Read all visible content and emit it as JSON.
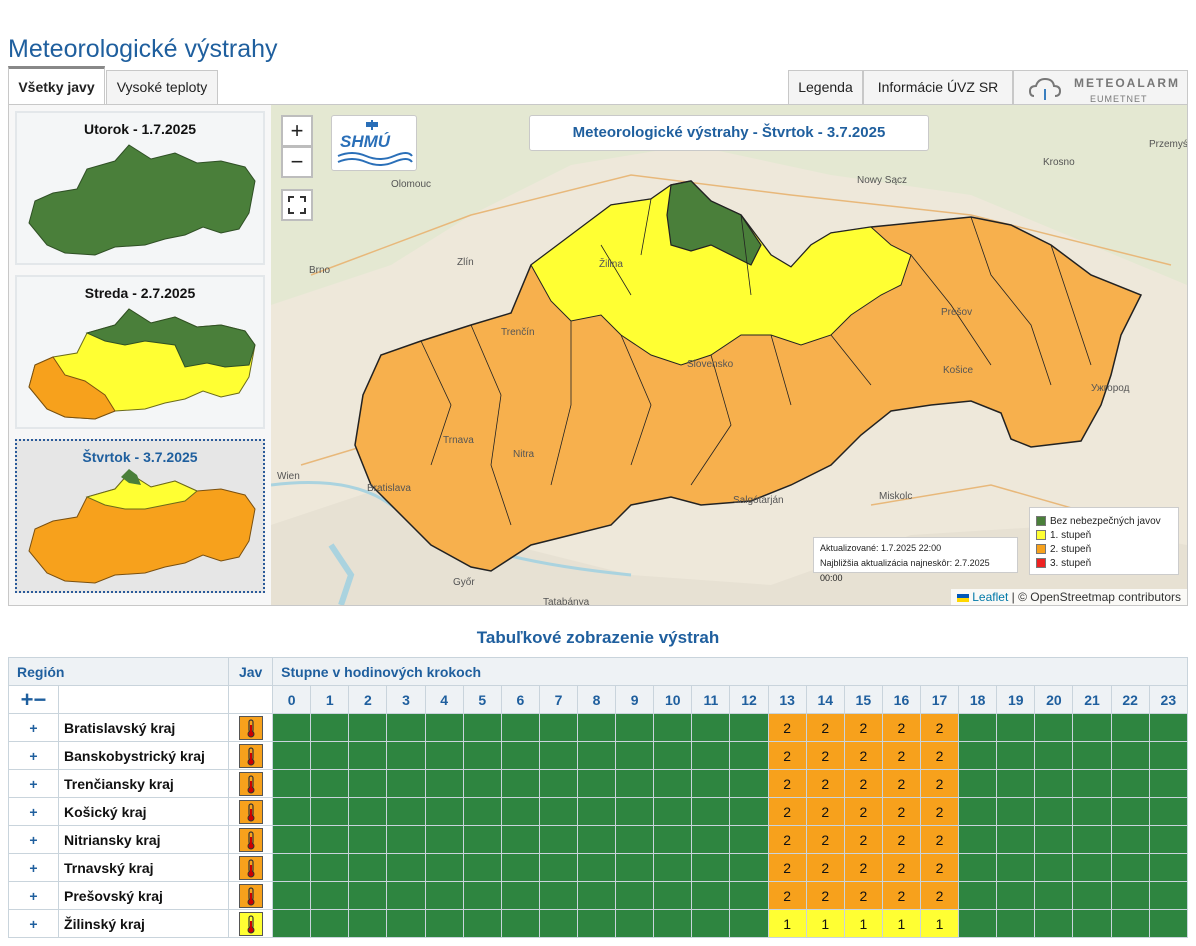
{
  "page": {
    "title": "Meteorologické výstrahy"
  },
  "tabs": {
    "left": [
      {
        "label": "Všetky javy",
        "active": true
      },
      {
        "label": "Vysoké teploty",
        "active": false
      }
    ],
    "right": [
      {
        "label": "Legenda"
      },
      {
        "label": "Informácie ÚVZ SR"
      }
    ],
    "meteoalarm": {
      "title": "METEOALARM",
      "subtitle": "EUMETNET"
    }
  },
  "days": [
    {
      "label": "Utorok - 1.7.2025",
      "selected": false
    },
    {
      "label": "Streda - 2.7.2025",
      "selected": false
    },
    {
      "label": "Štvrtok - 3.7.2025",
      "selected": true
    }
  ],
  "map": {
    "title": "Meteorologické výstrahy - Štvrtok - 3.7.2025",
    "zoom_in": "+",
    "zoom_out": "−",
    "fullscreen_icon": "fullscreen-icon",
    "logo_text": "SHMÚ",
    "cities": [
      "Olomouc",
      "Zlín",
      "Brno",
      "Nowy Sącz",
      "Krosno",
      "Przemyś",
      "Žilina",
      "Trenčín",
      "Prešov",
      "Košice",
      "Slovensko",
      "Ужгород",
      "Trnava",
      "Nitra",
      "Wien",
      "Bratislava",
      "Győr",
      "Salgótarján",
      "Miskolc",
      "Tatabánya"
    ],
    "update": {
      "updated": "Aktualizované: 1.7.2025 22:00",
      "next": "Najbližšia aktualizácia najneskôr: 2.7.2025 00:00"
    },
    "legend": [
      {
        "label": "Bez nebezpečných javov",
        "color": "#4a7f3a"
      },
      {
        "label": "1. stupeň",
        "color": "#ffff33"
      },
      {
        "label": "2. stupeň",
        "color": "#f7a11c"
      },
      {
        "label": "3. stupeň",
        "color": "#ee2222"
      }
    ],
    "attribution": {
      "leaflet": "Leaflet",
      "osm": "| © OpenStreetmap contributors"
    }
  },
  "colors": {
    "green": "#2e8540",
    "yellow": "#ffff33",
    "orange": "#f7a11c",
    "red": "#ee2222",
    "title_blue": "#1f5f9e"
  },
  "table": {
    "title": "Tabuľkové zobrazenie výstrah",
    "header": {
      "region": "Región",
      "jav": "Jav",
      "steps": "Stupne v hodinových krokoch"
    },
    "expand_collapse": "+−",
    "hours": [
      "0",
      "1",
      "2",
      "3",
      "4",
      "5",
      "6",
      "7",
      "8",
      "9",
      "10",
      "11",
      "12",
      "13",
      "14",
      "15",
      "16",
      "17",
      "18",
      "19",
      "20",
      "21",
      "22",
      "23"
    ],
    "rows": [
      {
        "region": "Bratislavský kraj",
        "jav_level": 2,
        "levels": [
          0,
          0,
          0,
          0,
          0,
          0,
          0,
          0,
          0,
          0,
          0,
          0,
          0,
          2,
          2,
          2,
          2,
          2,
          0,
          0,
          0,
          0,
          0,
          0
        ]
      },
      {
        "region": "Banskobystrický kraj",
        "jav_level": 2,
        "levels": [
          0,
          0,
          0,
          0,
          0,
          0,
          0,
          0,
          0,
          0,
          0,
          0,
          0,
          2,
          2,
          2,
          2,
          2,
          0,
          0,
          0,
          0,
          0,
          0
        ]
      },
      {
        "region": "Trenčiansky kraj",
        "jav_level": 2,
        "levels": [
          0,
          0,
          0,
          0,
          0,
          0,
          0,
          0,
          0,
          0,
          0,
          0,
          0,
          2,
          2,
          2,
          2,
          2,
          0,
          0,
          0,
          0,
          0,
          0
        ]
      },
      {
        "region": "Košický kraj",
        "jav_level": 2,
        "levels": [
          0,
          0,
          0,
          0,
          0,
          0,
          0,
          0,
          0,
          0,
          0,
          0,
          0,
          2,
          2,
          2,
          2,
          2,
          0,
          0,
          0,
          0,
          0,
          0
        ]
      },
      {
        "region": "Nitriansky kraj",
        "jav_level": 2,
        "levels": [
          0,
          0,
          0,
          0,
          0,
          0,
          0,
          0,
          0,
          0,
          0,
          0,
          0,
          2,
          2,
          2,
          2,
          2,
          0,
          0,
          0,
          0,
          0,
          0
        ]
      },
      {
        "region": "Trnavský kraj",
        "jav_level": 2,
        "levels": [
          0,
          0,
          0,
          0,
          0,
          0,
          0,
          0,
          0,
          0,
          0,
          0,
          0,
          2,
          2,
          2,
          2,
          2,
          0,
          0,
          0,
          0,
          0,
          0
        ]
      },
      {
        "region": "Prešovský kraj",
        "jav_level": 2,
        "levels": [
          0,
          0,
          0,
          0,
          0,
          0,
          0,
          0,
          0,
          0,
          0,
          0,
          0,
          2,
          2,
          2,
          2,
          2,
          0,
          0,
          0,
          0,
          0,
          0
        ]
      },
      {
        "region": "Žilinský kraj",
        "jav_level": 1,
        "levels": [
          0,
          0,
          0,
          0,
          0,
          0,
          0,
          0,
          0,
          0,
          0,
          0,
          0,
          1,
          1,
          1,
          1,
          1,
          0,
          0,
          0,
          0,
          0,
          0
        ]
      }
    ]
  }
}
